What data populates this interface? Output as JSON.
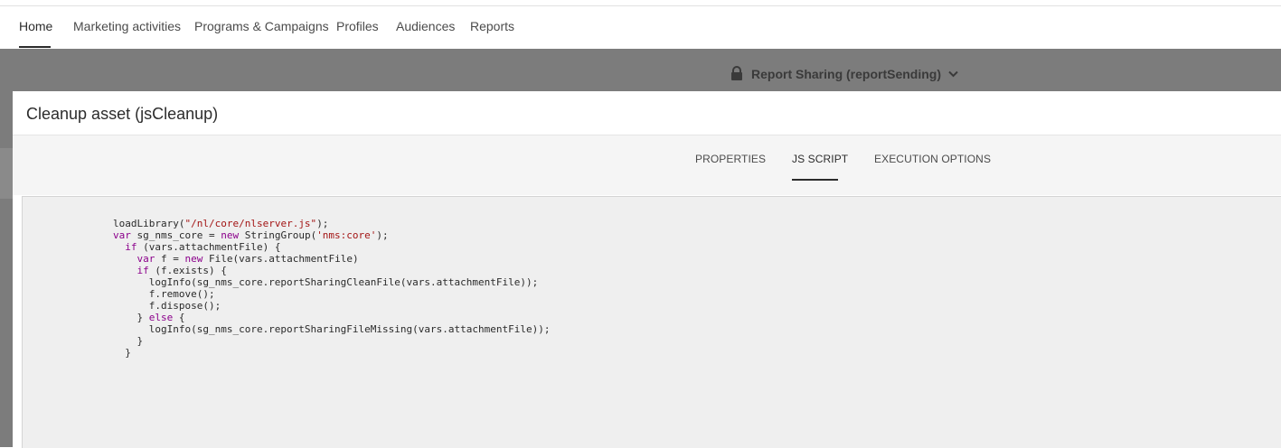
{
  "nav": {
    "items": [
      {
        "label": "Home",
        "active": true
      },
      {
        "label": "Marketing activities",
        "active": false
      },
      {
        "label": "Programs & Campaigns",
        "active": false
      },
      {
        "label": "Profiles",
        "active": false
      },
      {
        "label": "Audiences",
        "active": false
      },
      {
        "label": "Reports",
        "active": false
      }
    ]
  },
  "workspace": {
    "title": "Report Sharing (reportSending)",
    "lock_icon": "lock-icon",
    "dropdown_icon": "chevron-down-icon"
  },
  "modal": {
    "title": "Cleanup asset (jsCleanup)",
    "tabs": [
      {
        "label": "PROPERTIES",
        "active": false
      },
      {
        "label": "JS SCRIPT",
        "active": true
      },
      {
        "label": "EXECUTION OPTIONS",
        "active": false
      }
    ],
    "code_lines": [
      [
        {
          "t": "plain",
          "v": "loadLibrary("
        },
        {
          "t": "str",
          "v": "\"/nl/core/nlserver.js\""
        },
        {
          "t": "plain",
          "v": ");"
        }
      ],
      [
        {
          "t": "kw",
          "v": "var"
        },
        {
          "t": "plain",
          "v": " sg_nms_core = "
        },
        {
          "t": "kw",
          "v": "new"
        },
        {
          "t": "plain",
          "v": " StringGroup("
        },
        {
          "t": "str",
          "v": "'nms:core'"
        },
        {
          "t": "plain",
          "v": ");"
        }
      ],
      [
        {
          "t": "plain",
          "v": "  "
        },
        {
          "t": "kw",
          "v": "if"
        },
        {
          "t": "plain",
          "v": " (vars.attachmentFile) {"
        }
      ],
      [
        {
          "t": "plain",
          "v": "    "
        },
        {
          "t": "kw",
          "v": "var"
        },
        {
          "t": "plain",
          "v": " f = "
        },
        {
          "t": "kw",
          "v": "new"
        },
        {
          "t": "plain",
          "v": " File(vars.attachmentFile)"
        }
      ],
      [
        {
          "t": "plain",
          "v": "    "
        },
        {
          "t": "kw",
          "v": "if"
        },
        {
          "t": "plain",
          "v": " (f.exists) {"
        }
      ],
      [
        {
          "t": "plain",
          "v": "      logInfo(sg_nms_core.reportSharingCleanFile(vars.attachmentFile));"
        }
      ],
      [
        {
          "t": "plain",
          "v": "      f.remove();"
        }
      ],
      [
        {
          "t": "plain",
          "v": "      f.dispose();"
        }
      ],
      [
        {
          "t": "plain",
          "v": "    } "
        },
        {
          "t": "kw",
          "v": "else"
        },
        {
          "t": "plain",
          "v": " {"
        }
      ],
      [
        {
          "t": "plain",
          "v": "      logInfo(sg_nms_core.reportSharingFileMissing(vars.attachmentFile));"
        }
      ],
      [
        {
          "t": "plain",
          "v": "    }"
        }
      ],
      [
        {
          "t": "plain",
          "v": "  }"
        }
      ]
    ]
  },
  "colors": {
    "overlay": "#7c7c7c",
    "keyword": "#8b008b",
    "string": "#a31515",
    "code_bg": "#efefef"
  }
}
